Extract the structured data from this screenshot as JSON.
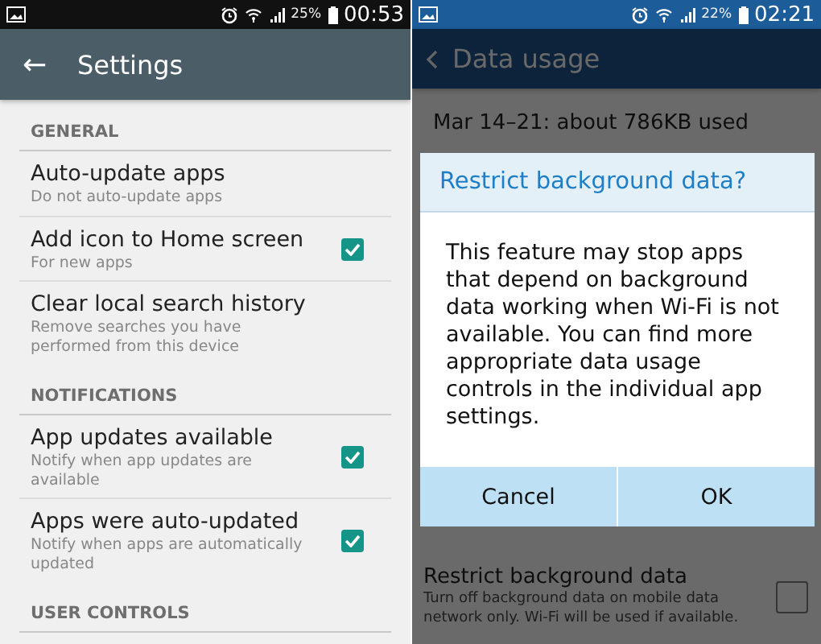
{
  "left_screen": {
    "status_bar": {
      "battery": "25%",
      "time": "00:53"
    },
    "toolbar": {
      "back": "←",
      "title": "Settings"
    },
    "sections": [
      {
        "header": "GENERAL",
        "items": [
          {
            "title": "Auto-update apps",
            "subtitle": "Do not auto-update apps",
            "kind": "plain"
          },
          {
            "title": "Add icon to Home screen",
            "subtitle": "For new apps",
            "kind": "checkbox",
            "checked": true
          },
          {
            "title": "Clear local search history",
            "subtitle": "Remove searches you have performed from this device",
            "kind": "plain"
          }
        ]
      },
      {
        "header": "NOTIFICATIONS",
        "items": [
          {
            "title": "App updates available",
            "subtitle": "Notify when app updates are available",
            "kind": "checkbox",
            "checked": true
          },
          {
            "title": "Apps were auto-updated",
            "subtitle": "Notify when apps are automatically updated",
            "kind": "checkbox",
            "checked": true
          }
        ]
      },
      {
        "header": "USER CONTROLS"
      }
    ]
  },
  "right_screen": {
    "status_bar": {
      "battery": "22%",
      "time": "02:21"
    },
    "toolbar": {
      "title": "Data usage"
    },
    "usage_summary": "Mar 14–21: about 786KB used",
    "dialog": {
      "title": "Restrict background data?",
      "message": "This feature may stop apps that depend on background data working when Wi-Fi is not available. You can find more appropriate data usage controls in the individual app settings.",
      "buttons": [
        "Cancel",
        "OK"
      ]
    },
    "setting": {
      "title": "Restrict background data",
      "subtitle": "Turn off background data on mobile data network only. Wi-Fi will be used if available.",
      "checked": false
    }
  }
}
